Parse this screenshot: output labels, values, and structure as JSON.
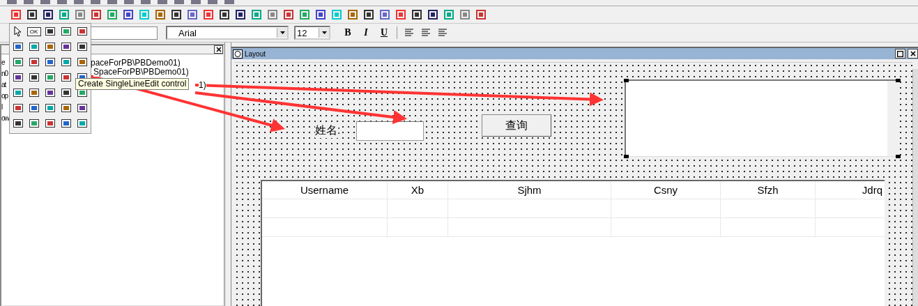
{
  "style_bar": {
    "font": "Arial",
    "size": "12",
    "bold": "B",
    "italic": "I",
    "underline": "U"
  },
  "left_panel": {
    "tree_lines": [
      {
        "left": "e",
        "right": "paceForPB\\PBDemo01)"
      },
      {
        "left": "n0",
        "right": "SpaceForPB\\PBDemo01)"
      },
      {
        "left": "at",
        "right": "1)"
      },
      {
        "left": "op"
      },
      {
        "left": "l"
      },
      {
        "left": "ow"
      }
    ]
  },
  "palette": {
    "ok_label": "OK"
  },
  "tooltip": "Create SingleLineEdit control",
  "layout_window": {
    "title": "Layout",
    "name_label": "姓名:",
    "query_button": "查询",
    "grid": {
      "columns": [
        "Username",
        "Xb",
        "Sjhm",
        "Csny",
        "Sfzh",
        "Jdrq"
      ],
      "rows": [
        {},
        {}
      ]
    }
  }
}
